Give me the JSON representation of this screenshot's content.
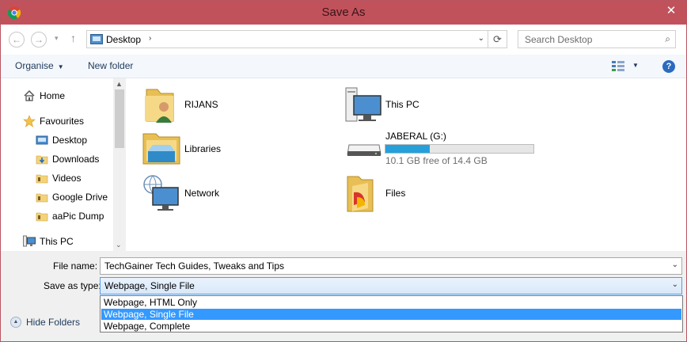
{
  "window": {
    "title": "Save As",
    "close_glyph": "✕"
  },
  "nav": {
    "back_glyph": "←",
    "forward_glyph": "→",
    "recent_glyph": "▾",
    "up_glyph": "↑",
    "address": "Desktop",
    "address_chevron": "›",
    "address_dropdown": "⌄",
    "refresh_glyph": "⟳",
    "search_placeholder": "Search Desktop",
    "search_glyph": "⌕"
  },
  "toolbar": {
    "organise": "Organise",
    "organise_caret": "▼",
    "new_folder": "New folder",
    "view_caret": "▼",
    "help": "?"
  },
  "sidebar": {
    "home": "Home",
    "favourites": "Favourites",
    "desktop": "Desktop",
    "downloads": "Downloads",
    "videos": "Videos",
    "google_drive": "Google Drive",
    "aapic_dump": "aaPic Dump",
    "this_pc": "This PC"
  },
  "scrollbar": {
    "up_glyph": "▲",
    "down_glyph": "⌄"
  },
  "items": {
    "rijans": "RIJANS",
    "libraries": "Libraries",
    "network": "Network",
    "this_pc": "This PC",
    "drive_name": "JABERAL (G:)",
    "drive_free": "10.1 GB free of 14.4 GB",
    "drive_used_fraction": 0.3,
    "files": "Files"
  },
  "form": {
    "file_name_label": "File name:",
    "file_name_value": "TechGainer   Tech Guides, Tweaks and Tips",
    "save_type_label": "Save as type:",
    "save_type_value": "Webpage, Single File",
    "dropdown_glyph": "⌄",
    "options": [
      "Webpage, HTML Only",
      "Webpage, Single File",
      "Webpage, Complete"
    ],
    "hide_folders": "Hide Folders",
    "hide_folders_glyph": "▲"
  },
  "colors": {
    "titlebar": "#c1525c",
    "selection": "#3399ff",
    "drive_bar": "#26a0da"
  },
  "icons": [
    "chrome-icon",
    "close-icon",
    "back-icon",
    "forward-icon",
    "up-icon",
    "desktop-icon",
    "refresh-icon",
    "search-icon",
    "view-options-icon",
    "help-icon",
    "home-icon",
    "star-icon",
    "folder-icon",
    "user-folder-icon",
    "libraries-icon",
    "network-icon",
    "computer-icon",
    "drive-icon",
    "files-folder-icon"
  ]
}
